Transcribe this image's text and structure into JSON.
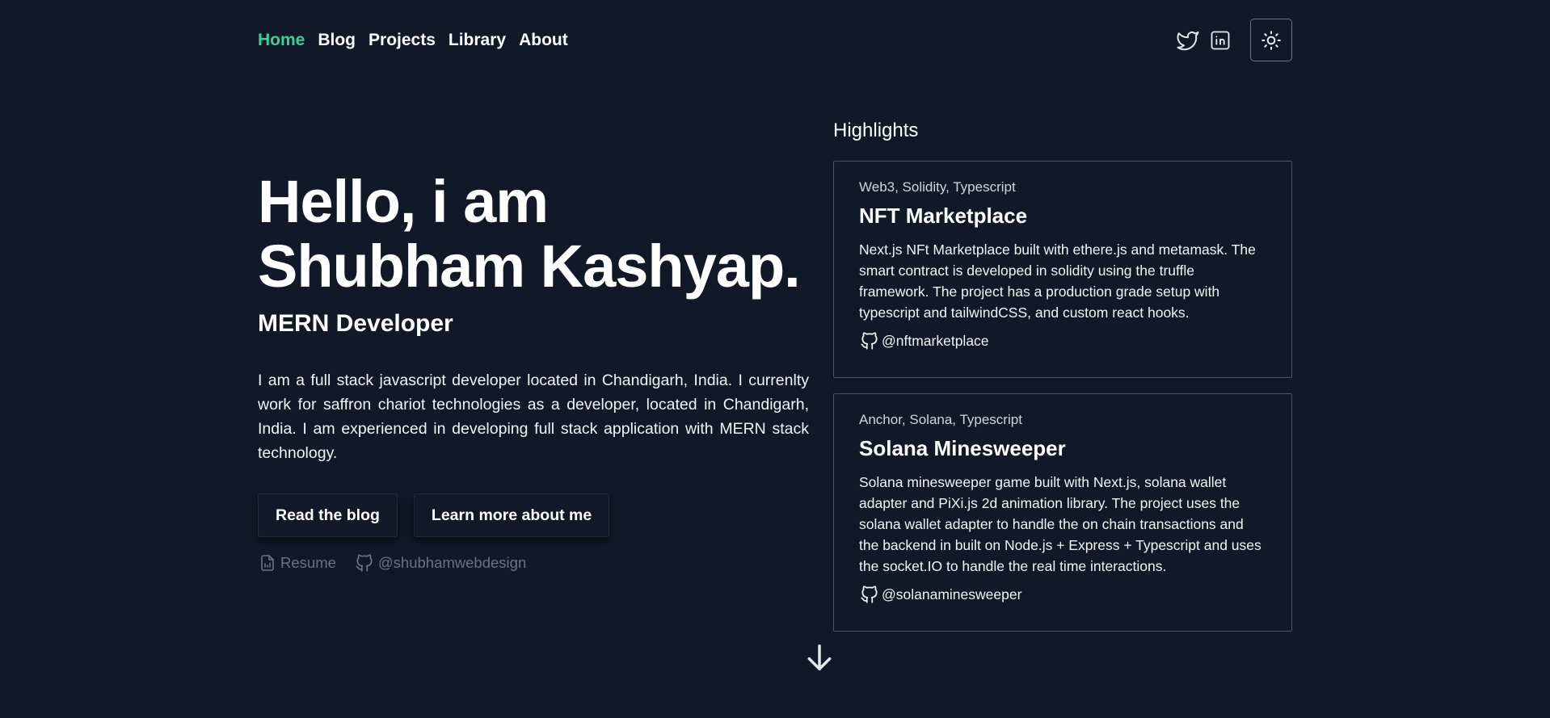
{
  "nav": {
    "items": [
      {
        "label": "Home",
        "active": true
      },
      {
        "label": "Blog"
      },
      {
        "label": "Projects"
      },
      {
        "label": "Library"
      },
      {
        "label": "About"
      }
    ]
  },
  "header": {
    "icons": [
      "twitter-icon",
      "linkedin-icon",
      "sun-icon"
    ]
  },
  "hero": {
    "title_line1": "Hello, i am",
    "title_line2": "Shubham Kashyap.",
    "subtitle": "MERN Developer",
    "description": "I am a full stack javascript developer located in Chandigarh, India. I currenlty work for saffron chariot technologies as a developer, located in Chandigarh, India. I am experienced in developing full stack application with MERN stack technology.",
    "buttons": {
      "blog": "Read the blog",
      "about": "Learn more about me"
    },
    "links": {
      "resume": "Resume",
      "github": "@shubhamwebdesign"
    }
  },
  "highlights": {
    "title": "Highlights",
    "cards": [
      {
        "tags": "Web3, Solidity, Typescript",
        "title": "NFT Marketplace",
        "description": "Next.js NFt Marketplace built with ethere.js and metamask. The smart contract is developed in solidity using the truffle framework. The project has a production grade setup with typescript and tailwindCSS, and custom react hooks.",
        "repo": "@nftmarketplace"
      },
      {
        "tags": "Anchor, Solana, Typescript",
        "title": "Solana Minesweeper",
        "description": "Solana minesweeper game built with Next.js, solana wallet adapter and PiXi.js 2d animation library. The project uses the solana wallet adapter to handle the on chain transactions and the backend in built on Node.js + Express + Typescript and uses the socket.IO to handle the real time interactions.",
        "repo": "@solanaminesweeper"
      }
    ]
  },
  "colors": {
    "background": "#111827",
    "accent": "#34d399",
    "muted": "#6b7280",
    "border": "#4b5563"
  }
}
